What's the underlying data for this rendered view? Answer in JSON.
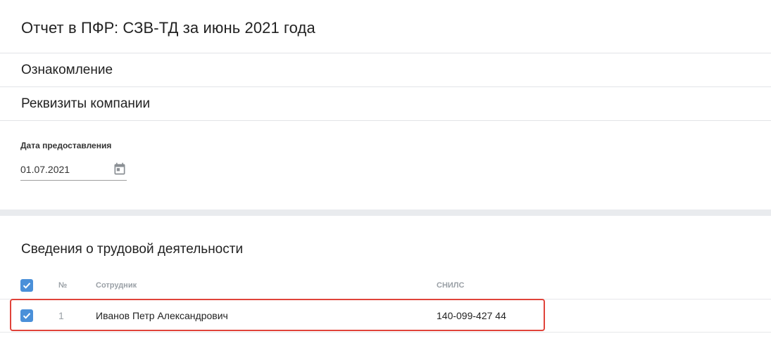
{
  "header": {
    "title": "Отчет в ПФР: СЗВ-ТД за июнь 2021 года"
  },
  "sections": {
    "intro": "Ознакомление",
    "company": "Реквизиты компании"
  },
  "submission_date": {
    "label": "Дата предоставления",
    "value": "01.07.2021",
    "icon": "calendar-icon"
  },
  "employment": {
    "title": "Сведения о трудовой деятельности",
    "select_all_checked": true,
    "columns": {
      "number": "№",
      "employee": "Сотрудник",
      "snils": "СНИЛС"
    },
    "rows": [
      {
        "checked": true,
        "number": "1",
        "employee": "Иванов Петр Александрович",
        "snils": "140-099-427 44"
      }
    ]
  },
  "colors": {
    "accent": "#4a90d9",
    "highlight": "#e0433a",
    "band": "#e9ebee"
  }
}
